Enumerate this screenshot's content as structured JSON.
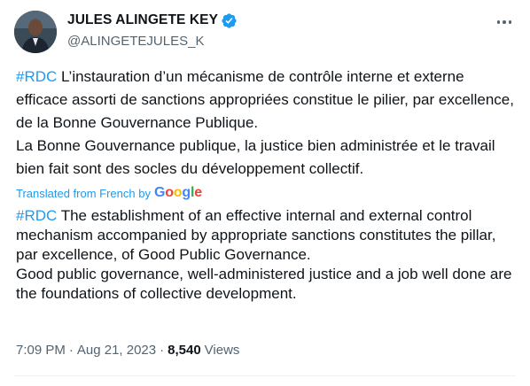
{
  "author": {
    "display_name": "JULES ALINGETE KEY",
    "handle": "@ALINGETEJULES_K",
    "verified": true,
    "verified_color": "#1d9bf0"
  },
  "menu": {
    "icon": "more-horizontal-icon"
  },
  "tweet": {
    "original": {
      "hashtag": "#RDC",
      "paragraph_1_text": " L’instauration d’un mécanisme de contrôle interne et externe efficace assorti de sanctions appropriées constitue le pilier, par excellence, de la Bonne Gouvernance Publique.",
      "paragraph_2": "La Bonne Gouvernance publique, la justice bien administrée et le travail bien fait sont des socles du développement collectif."
    },
    "translated_from_label": "Translated from French by",
    "translator": "Google",
    "translation": {
      "hashtag": "#RDC",
      "paragraph_1_text": " The establishment of an effective internal and external control mechanism accompanied by appropriate sanctions constitutes the pillar, par excellence, of Good Public Governance.",
      "paragraph_2": "Good public governance, well-administered justice and a job well done are the foundations of collective development."
    }
  },
  "meta": {
    "time": "7:09 PM",
    "separator": "·",
    "date": "Aug 21, 2023",
    "views_count": "8,540",
    "views_label": "Views"
  },
  "colors": {
    "link": "#1d9bf0",
    "text": "#0f1419",
    "secondary": "#536471"
  }
}
